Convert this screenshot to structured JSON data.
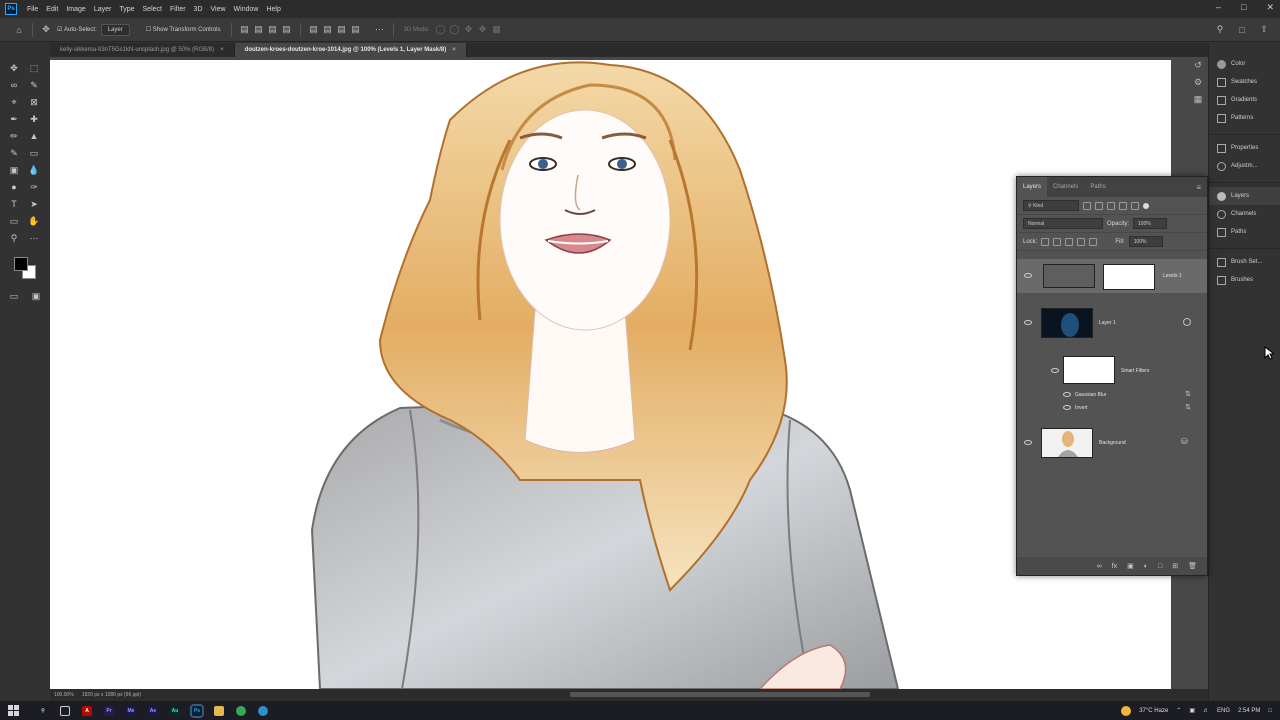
{
  "menubar": {
    "app_icon": "Ps",
    "items": [
      "File",
      "Edit",
      "Image",
      "Layer",
      "Type",
      "Select",
      "Filter",
      "3D",
      "View",
      "Window",
      "Help"
    ]
  },
  "options_bar": {
    "auto_select_label": "Auto-Select:",
    "auto_select_value": "Layer",
    "show_transform_label": "Show Transform Controls",
    "mode_3d_label": "3D Mode:"
  },
  "tabs": [
    {
      "label": "kelly-sikkema-93nT5Gs1kN-unsplash.jpg @ 50% (RGB/8)"
    },
    {
      "label": "doutzen-kroes-doutzen-kroe-1014.jpg @ 100% (Levels 1, Layer Mask/8)"
    }
  ],
  "dock": {
    "group1": [
      "Color",
      "Swatches",
      "Gradients",
      "Patterns"
    ],
    "group2": [
      "Properties",
      "Adjustm..."
    ],
    "group3": [
      "Layers",
      "Channels",
      "Paths"
    ],
    "group4": [
      "Brush Set...",
      "Brushes"
    ]
  },
  "layers_panel": {
    "tabs": [
      "Layers",
      "Channels",
      "Paths"
    ],
    "filter_label": "Kind",
    "blend_mode": "Normal",
    "opacity_label": "Opacity:",
    "opacity_value": "100%",
    "lock_label": "Lock:",
    "fill_label": "Fill:",
    "fill_value": "100%",
    "layers": [
      {
        "name": "Levels 1"
      },
      {
        "name": "Layer 1"
      },
      {
        "name": "Smart Filters"
      },
      {
        "name": "Gaussian Blur"
      },
      {
        "name": "Invert"
      },
      {
        "name": "Background"
      }
    ]
  },
  "statusbar": {
    "zoom": "100.00%",
    "doc_info": "1920 px x 1080 px (96 ppi)"
  },
  "taskbar": {
    "weather": "37°C  Haze",
    "lang": "ENG",
    "time": "2:54 PM"
  },
  "colors": {
    "foreground": "#000000",
    "background": "#ffffff",
    "accent": "#31a8ff"
  }
}
